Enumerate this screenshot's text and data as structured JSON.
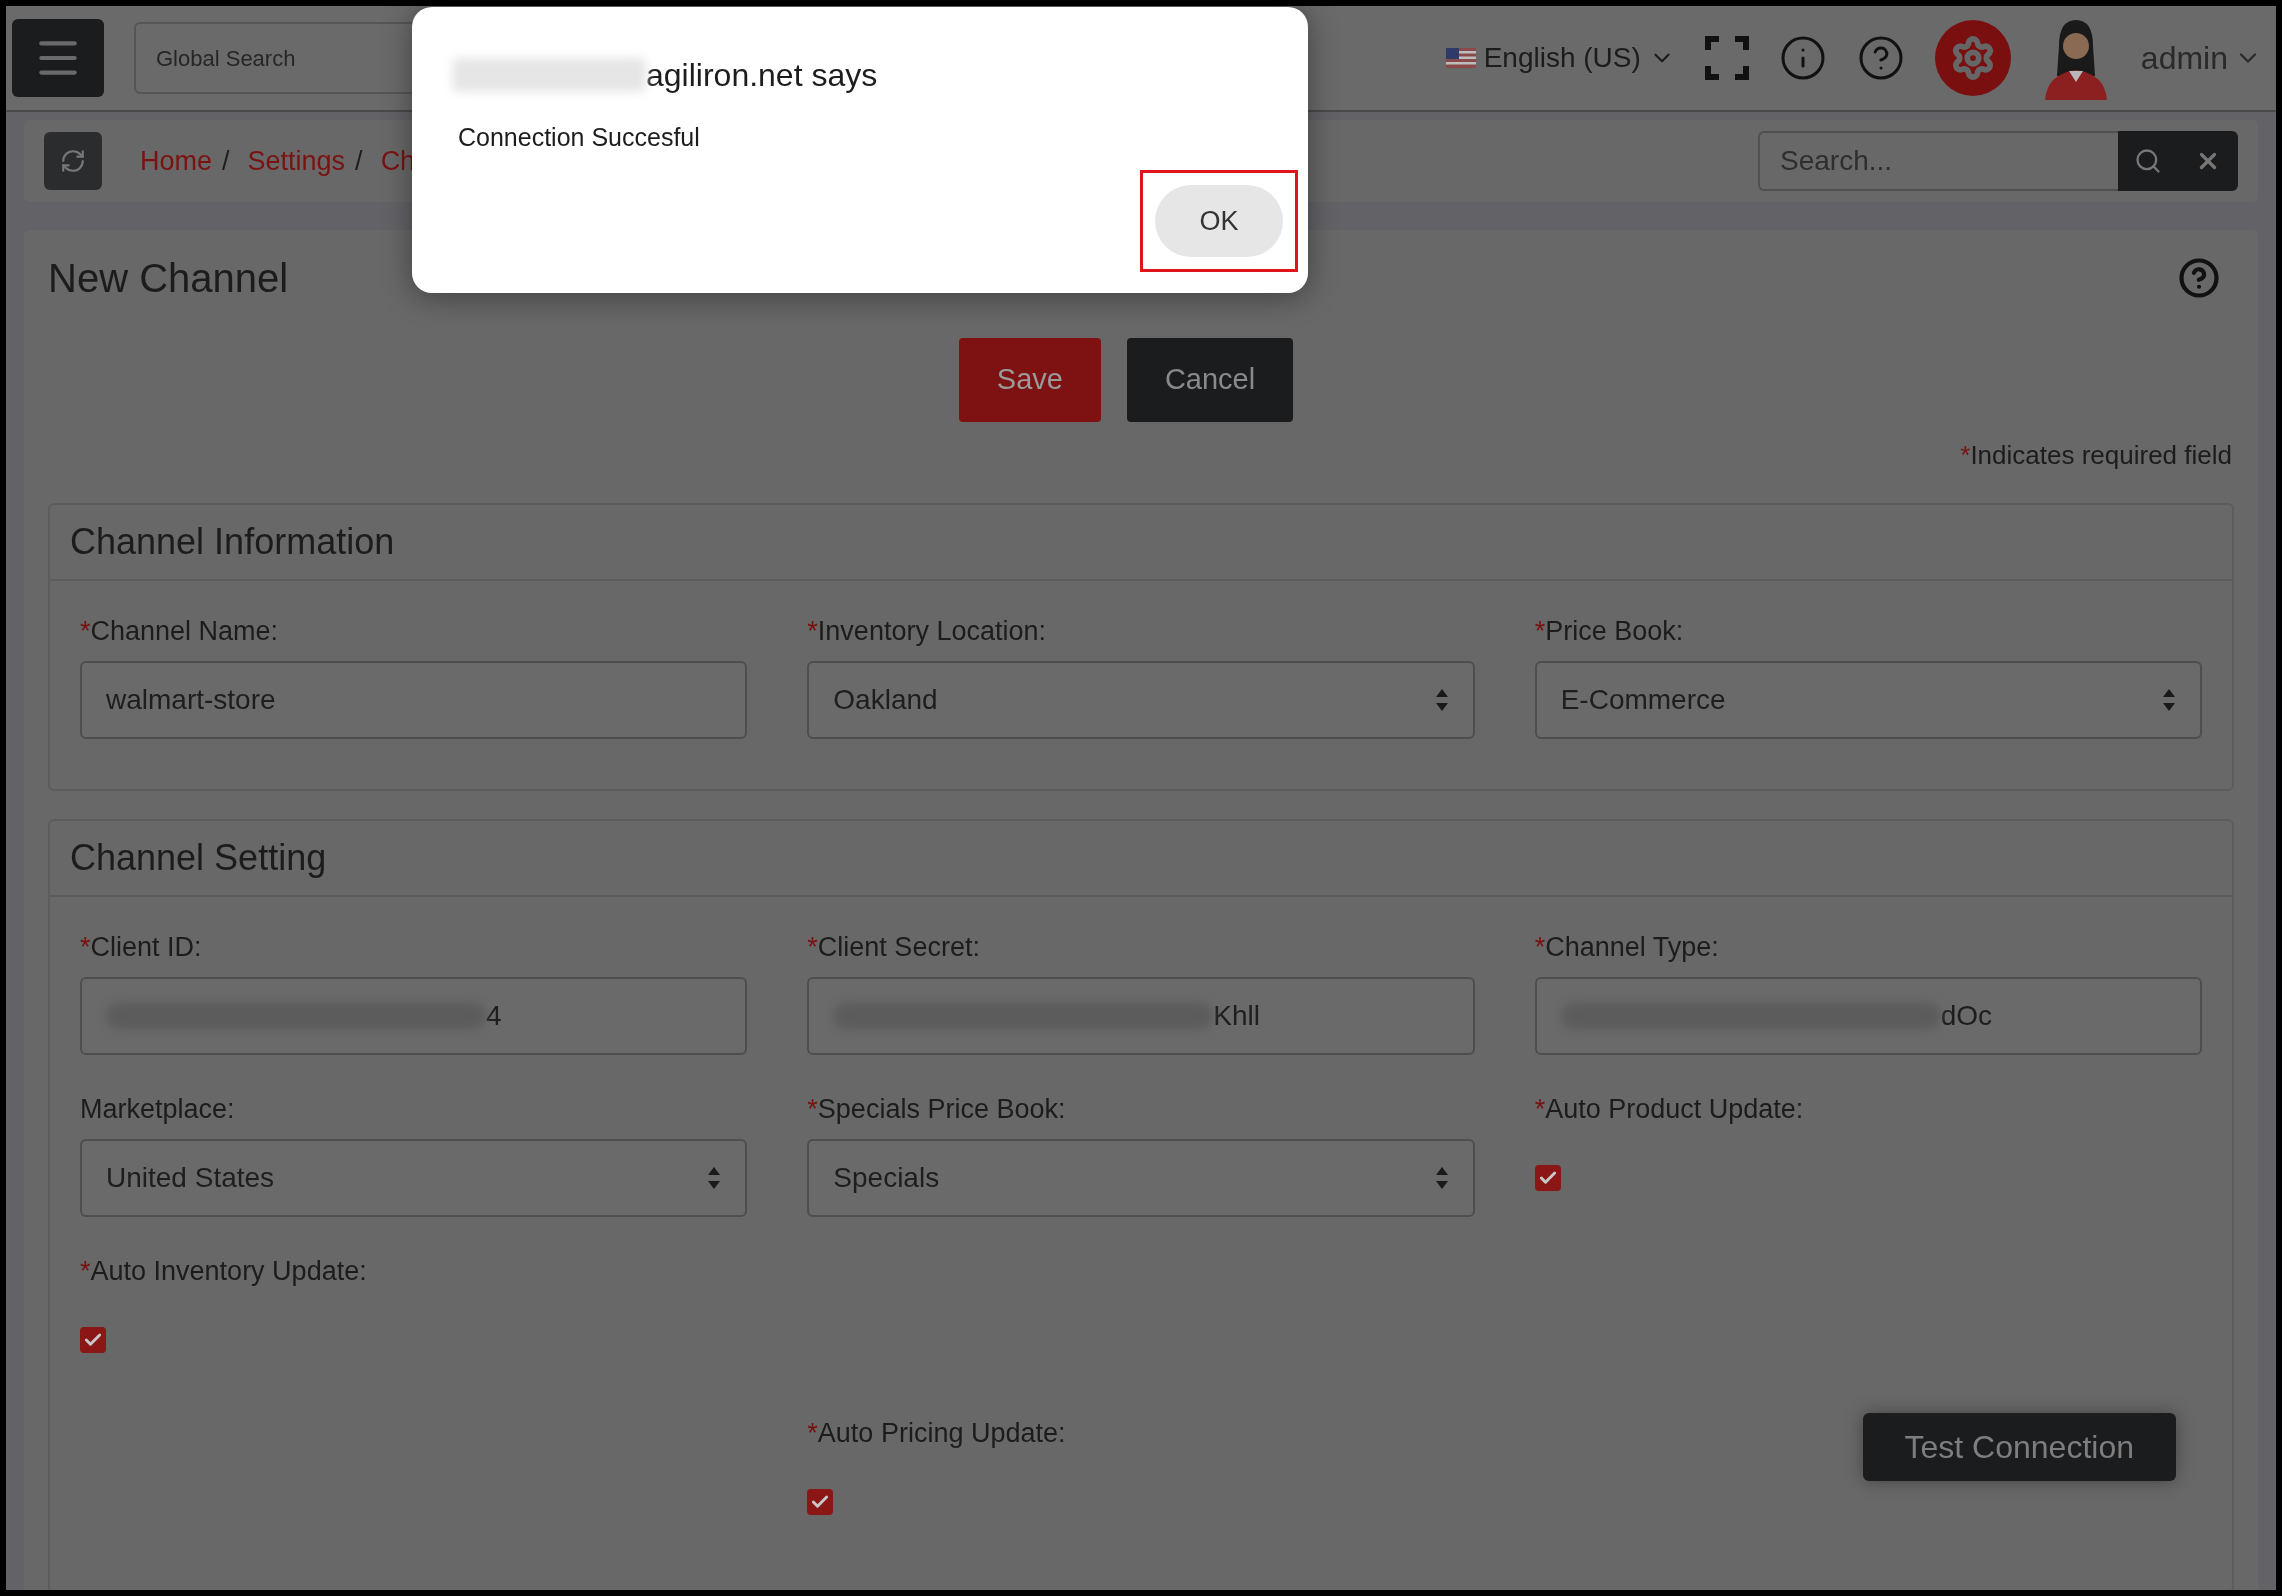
{
  "top_bar": {
    "search_placeholder": "Global Search",
    "language": "English (US)",
    "user": "admin"
  },
  "breadcrumb": [
    "Home",
    "Settings",
    "Ch"
  ],
  "breadcrumb_separator": "/",
  "search": {
    "placeholder": "Search..."
  },
  "page": {
    "title": "New Channel",
    "buttons": [
      {
        "label": "Save",
        "kind": "primary"
      },
      {
        "label": "Cancel",
        "kind": "dark"
      }
    ],
    "required_note": "Indicates required field"
  },
  "required_mark": "*",
  "sections": [
    {
      "title": "Channel Information",
      "fields": [
        {
          "label": "Channel Name:",
          "required": true,
          "kind": "text",
          "value": "walmart-store"
        },
        {
          "label": "Inventory Location:",
          "required": true,
          "kind": "select",
          "value": "Oakland"
        },
        {
          "label": "Price Book:",
          "required": true,
          "kind": "select",
          "value": "E-Commerce"
        }
      ]
    },
    {
      "title": "Channel Setting",
      "fields": [
        {
          "label": "Client ID:",
          "required": true,
          "kind": "masked",
          "value": "4"
        },
        {
          "label": "Client Secret:",
          "required": true,
          "kind": "masked",
          "value": "Khll"
        },
        {
          "label": "Channel Type:",
          "required": true,
          "kind": "masked",
          "value": "dOc"
        },
        {
          "label": "Marketplace:",
          "required": false,
          "kind": "select",
          "value": "United States"
        },
        {
          "label": "Specials Price Book:",
          "required": true,
          "kind": "select",
          "value": "Specials"
        },
        {
          "label": "Auto Product Update:",
          "required": true,
          "kind": "checkbox",
          "checked": true
        },
        {
          "label": "Auto Inventory Update:",
          "required": true,
          "kind": "checkbox",
          "checked": true
        },
        {
          "label": "Auto Pricing Update:",
          "required": true,
          "kind": "checkbox",
          "checked": true
        }
      ],
      "action": "Test Connection"
    }
  ],
  "dialog": {
    "title": "agiliron.net says",
    "message": "Connection Succesful",
    "button": "OK",
    "highlighted": true
  }
}
